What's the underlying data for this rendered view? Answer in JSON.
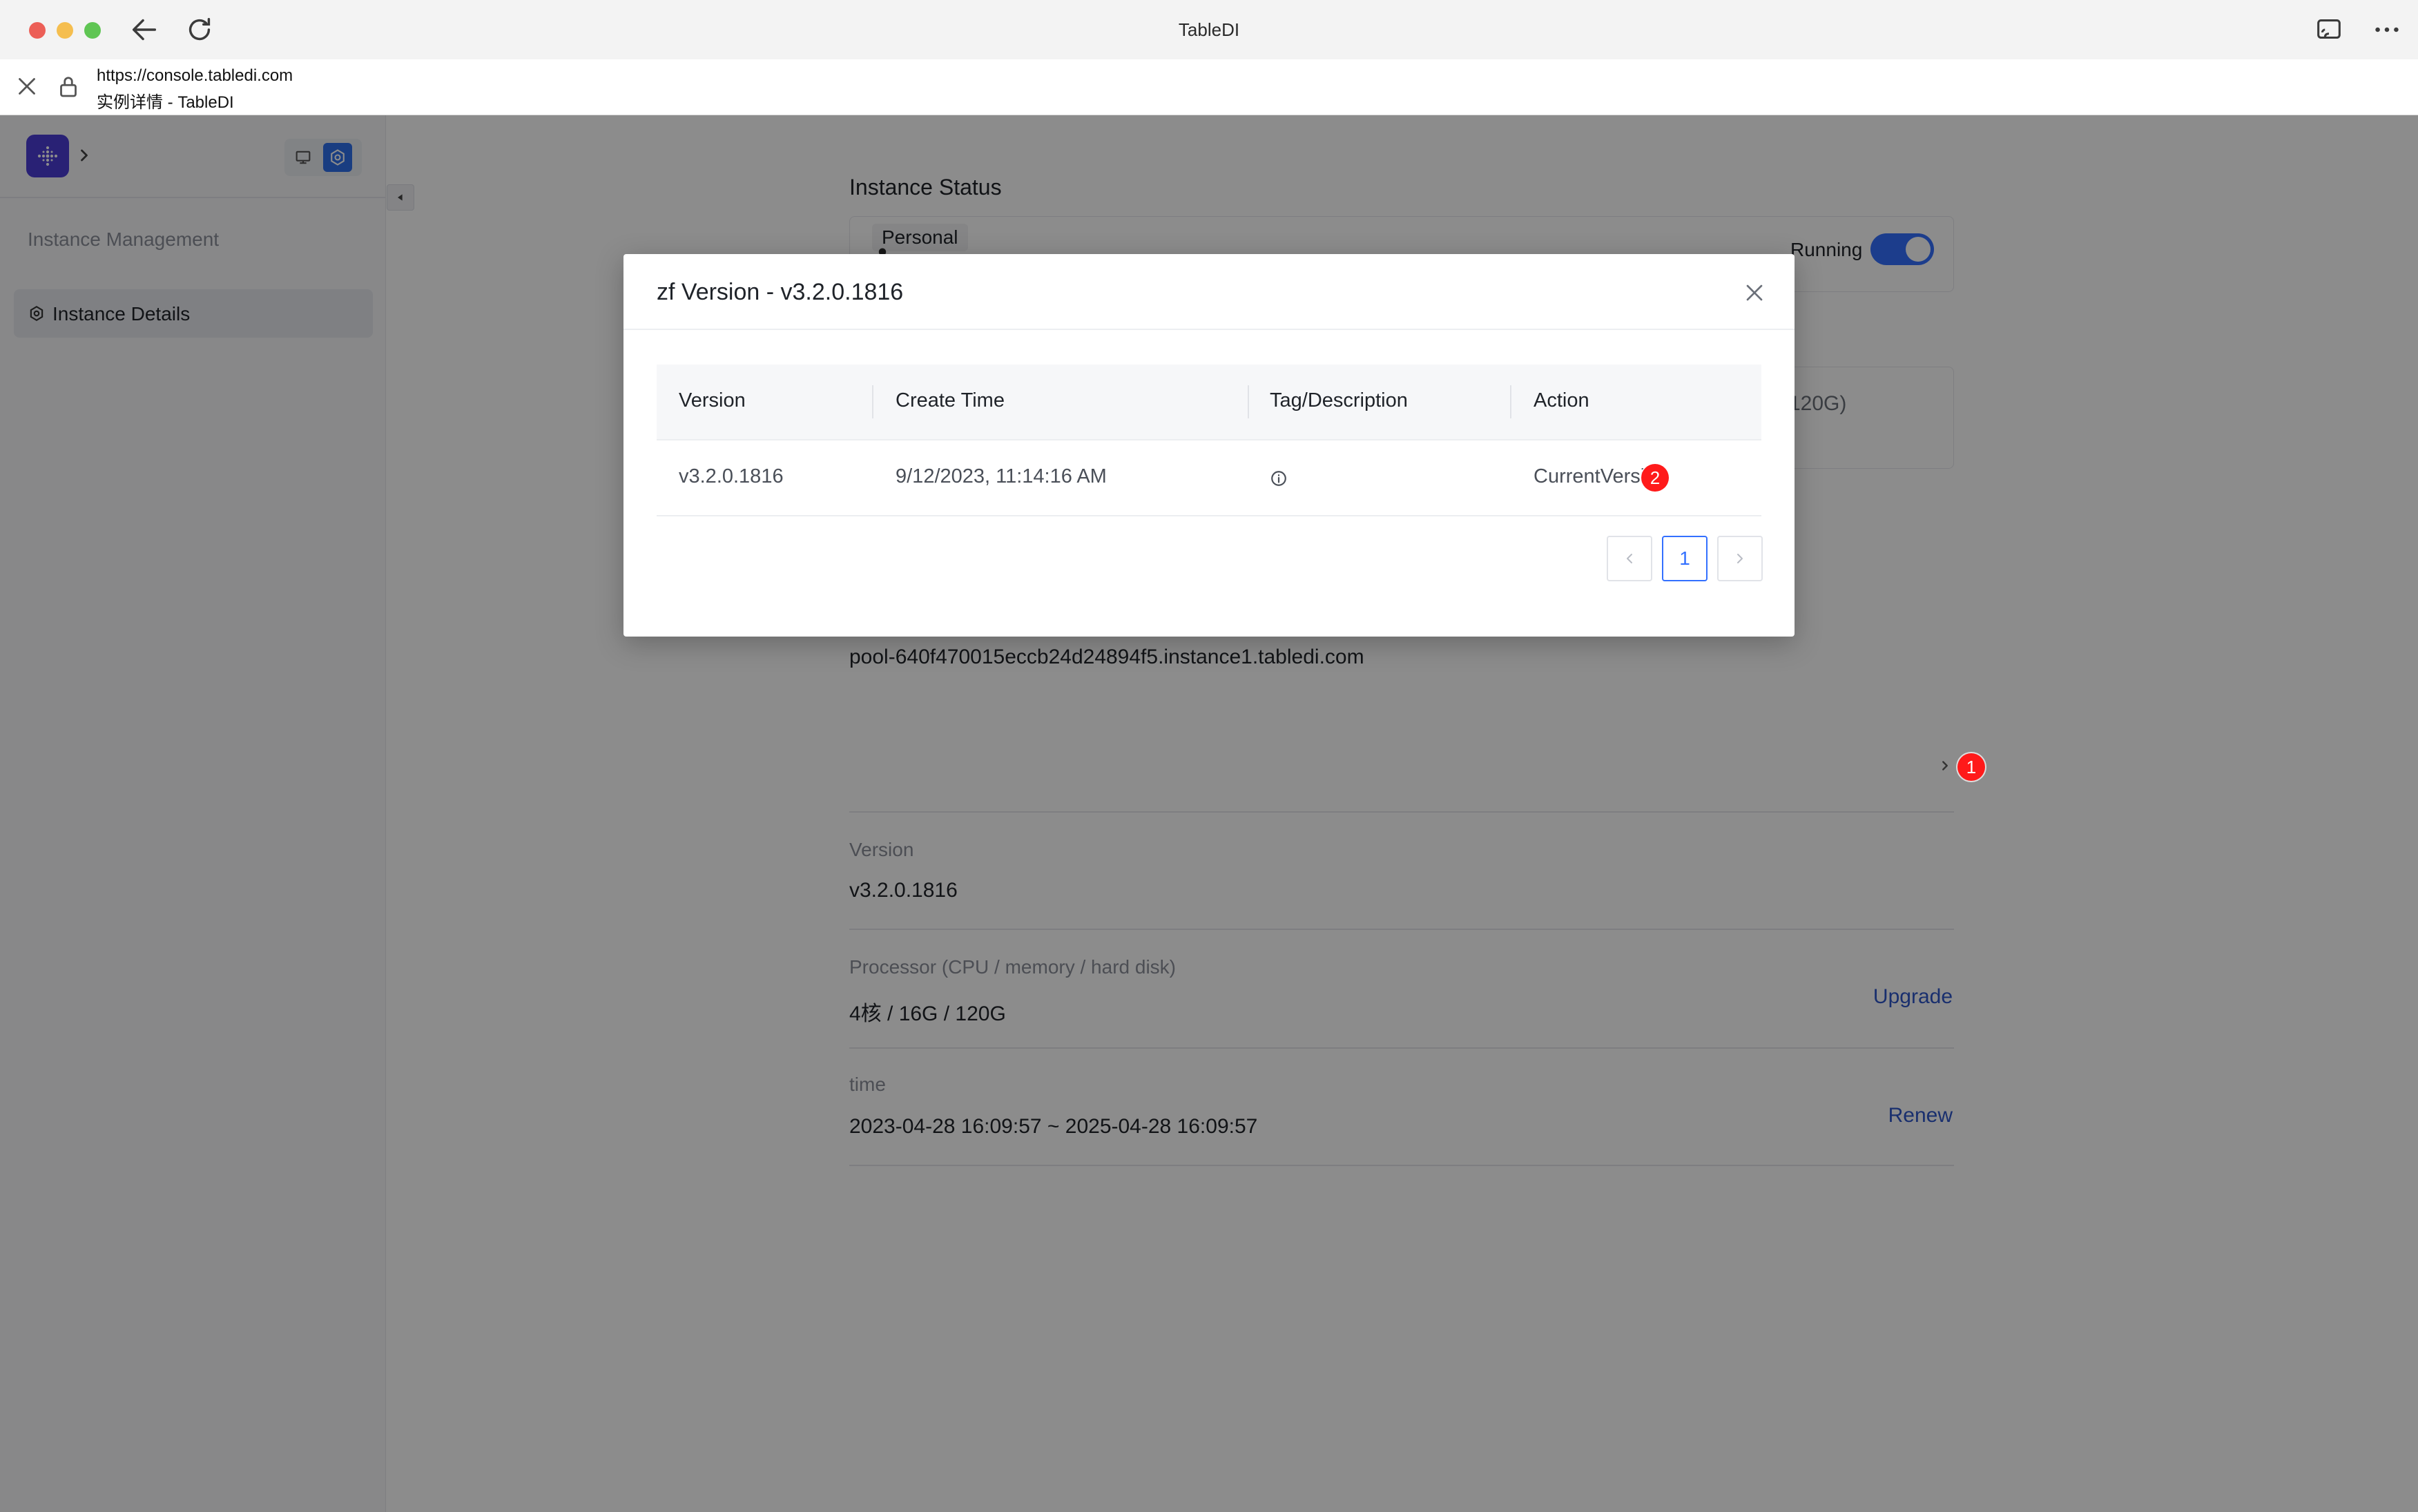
{
  "window": {
    "title": "TableDI"
  },
  "address_bar": {
    "url": "https://console.tabledi.com",
    "page_title": "实例详情 - TableDI"
  },
  "sidebar": {
    "section_label": "Instance Management",
    "items": [
      {
        "label": "Instance Details",
        "icon": "gear-icon",
        "selected": true
      }
    ]
  },
  "main": {
    "status_section_title": "Instance Status",
    "plan_badge": "Personal",
    "running_label": "Running",
    "running_on": true,
    "spec_partial": "120G)",
    "domain_value": "pool-640f470015eccb24d24894f5.instance1.tabledi.com",
    "version": {
      "label": "Version",
      "value": "v3.2.0.1816",
      "badge": "1"
    },
    "processor": {
      "label": "Processor (CPU / memory / hard disk)",
      "value": "4核 / 16G / 120G",
      "action": "Upgrade"
    },
    "time": {
      "label": "time",
      "value": "2023-04-28 16:09:57 ~ 2025-04-28 16:09:57",
      "action": "Renew"
    }
  },
  "modal": {
    "title": "zf Version - v3.2.0.1816",
    "columns": [
      "Version",
      "Create Time",
      "Tag/Description",
      "Action"
    ],
    "rows": [
      {
        "version": "v3.2.0.1816",
        "create_time": "9/12/2023, 11:14:16 AM",
        "tag_icon": "info-icon",
        "action": "CurrentVersion",
        "badge": "2"
      }
    ],
    "pagination": {
      "current_page": "1"
    }
  },
  "colors": {
    "accent": "#3370ff",
    "link": "#2f56c9",
    "badge": "#ff1a1a",
    "overlay": "rgba(0,0,0,0.45)"
  }
}
